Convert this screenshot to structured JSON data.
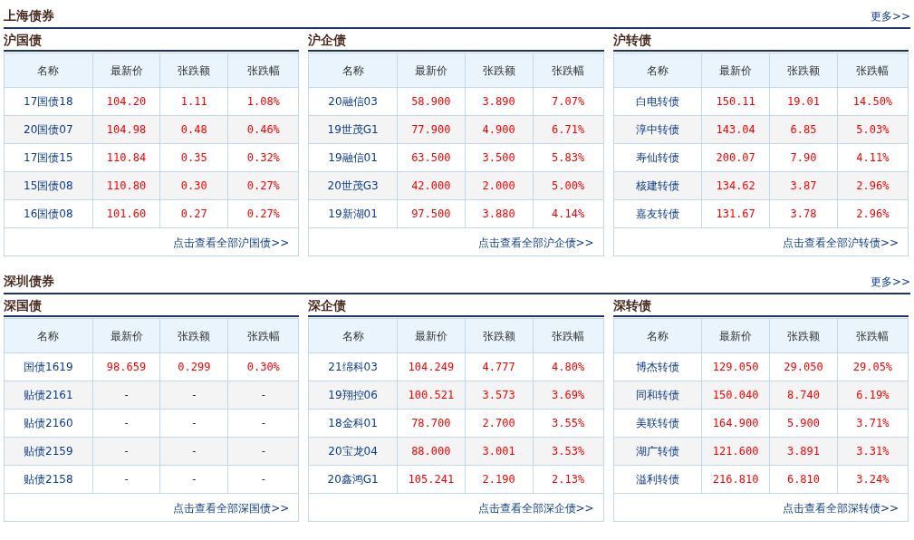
{
  "sections": [
    {
      "title": "上海债券",
      "more": "更多>>",
      "panels": [
        {
          "title": "沪国债",
          "columns": [
            "名称",
            "最新价",
            "张跌额",
            "张跌幅"
          ],
          "footer_link": "点击查看全部沪国债>>",
          "rows": [
            {
              "name": "17国债18",
              "color": "#ff0000",
              "price": "104.20",
              "change": "1.11",
              "pct": "1.08%"
            },
            {
              "name": "20国债07",
              "color": "#ff0000",
              "price": "104.98",
              "change": "0.48",
              "pct": "0.46%"
            },
            {
              "name": "17国债15",
              "color": "#ff0000",
              "price": "110.84",
              "change": "0.35",
              "pct": "0.32%"
            },
            {
              "name": "15国债08",
              "color": "#ff0000",
              "price": "110.80",
              "change": "0.30",
              "pct": "0.27%"
            },
            {
              "name": "16国债08",
              "color": "#ff0000",
              "price": "101.60",
              "change": "0.27",
              "pct": "0.27%"
            }
          ]
        },
        {
          "title": "沪企债",
          "columns": [
            "名称",
            "最新价",
            "张跌额",
            "张跌幅"
          ],
          "footer_link": "点击查看全部沪企债>>",
          "rows": [
            {
              "name": "20融信03",
              "color": "#ff0000",
              "price": "58.900",
              "change": "3.890",
              "pct": "7.07%"
            },
            {
              "name": "19世茂G1",
              "color": "#ff0000",
              "price": "77.900",
              "change": "4.900",
              "pct": "6.71%"
            },
            {
              "name": "19融信01",
              "color": "#ff0000",
              "price": "63.500",
              "change": "3.500",
              "pct": "5.83%"
            },
            {
              "name": "20世茂G3",
              "color": "#ff0000",
              "price": "42.000",
              "change": "2.000",
              "pct": "5.00%"
            },
            {
              "name": "19新湖01",
              "color": "#ff0000",
              "price": "97.500",
              "change": "3.880",
              "pct": "4.14%"
            }
          ]
        },
        {
          "title": "沪转债",
          "columns": [
            "名称",
            "最新价",
            "张跌额",
            "张跌幅"
          ],
          "footer_link": "点击查看全部沪转债>>",
          "rows": [
            {
              "name": "白电转债",
              "color": "#ff0000",
              "price": "150.11",
              "change": "19.01",
              "pct": "14.50%"
            },
            {
              "name": "淳中转债",
              "color": "#ff0000",
              "price": "143.04",
              "change": "6.85",
              "pct": "5.03%"
            },
            {
              "name": "寿仙转债",
              "color": "#ff0000",
              "price": "200.07",
              "change": "7.90",
              "pct": "4.11%"
            },
            {
              "name": "核建转债",
              "color": "#ff0000",
              "price": "134.62",
              "change": "3.87",
              "pct": "2.96%"
            },
            {
              "name": "嘉友转债",
              "color": "#ff0000",
              "price": "131.67",
              "change": "3.78",
              "pct": "2.96%"
            }
          ]
        }
      ]
    },
    {
      "title": "深圳债券",
      "more": "更多>>",
      "panels": [
        {
          "title": "深国债",
          "columns": [
            "名称",
            "最新价",
            "张跌额",
            "张跌幅"
          ],
          "footer_link": "点击查看全部深国债>>",
          "rows": [
            {
              "name": "国债1619",
              "color": "#ff0000",
              "price": "98.659",
              "change": "0.299",
              "pct": "0.30%"
            },
            {
              "name": "贴债2161",
              "price": "-",
              "change": "-",
              "pct": "-"
            },
            {
              "name": "贴债2160",
              "price": "-",
              "change": "-",
              "pct": "-"
            },
            {
              "name": "贴债2159",
              "price": "-",
              "change": "-",
              "pct": "-"
            },
            {
              "name": "贴债2158",
              "price": "-",
              "change": "-",
              "pct": "-"
            }
          ]
        },
        {
          "title": "深企债",
          "columns": [
            "名称",
            "最新价",
            "张跌额",
            "张跌幅"
          ],
          "footer_link": "点击查看全部深企债>>",
          "rows": [
            {
              "name": "21绵科03",
              "color": "#ff0000",
              "price": "104.249",
              "change": "4.777",
              "pct": "4.80%"
            },
            {
              "name": "19翔控06",
              "color": "#ff0000",
              "price": "100.521",
              "change": "3.573",
              "pct": "3.69%"
            },
            {
              "name": "18金科01",
              "color": "#ff0000",
              "price": "78.700",
              "change": "2.700",
              "pct": "3.55%"
            },
            {
              "name": "20宝龙04",
              "color": "#ff0000",
              "price": "88.000",
              "change": "3.001",
              "pct": "3.53%"
            },
            {
              "name": "20鑫鸿G1",
              "color": "#ff0000",
              "price": "105.241",
              "change": "2.190",
              "pct": "2.13%"
            }
          ]
        },
        {
          "title": "深转债",
          "columns": [
            "名称",
            "最新价",
            "张跌额",
            "张跌幅"
          ],
          "footer_link": "点击查看全部深转债>>",
          "rows": [
            {
              "name": "博杰转债",
              "color": "#ff0000",
              "price": "129.050",
              "change": "29.050",
              "pct": "29.05%"
            },
            {
              "name": "同和转债",
              "color": "#ff0000",
              "price": "150.040",
              "change": "8.740",
              "pct": "6.19%"
            },
            {
              "name": "美联转债",
              "color": "#ff0000",
              "price": "164.900",
              "change": "5.900",
              "pct": "3.71%"
            },
            {
              "name": "湖广转债",
              "color": "#ff0000",
              "price": "121.600",
              "change": "3.891",
              "pct": "3.31%"
            },
            {
              "name": "溢利转债",
              "color": "#ff0000",
              "price": "216.810",
              "change": "6.810",
              "pct": "3.24%"
            }
          ]
        }
      ]
    }
  ]
}
